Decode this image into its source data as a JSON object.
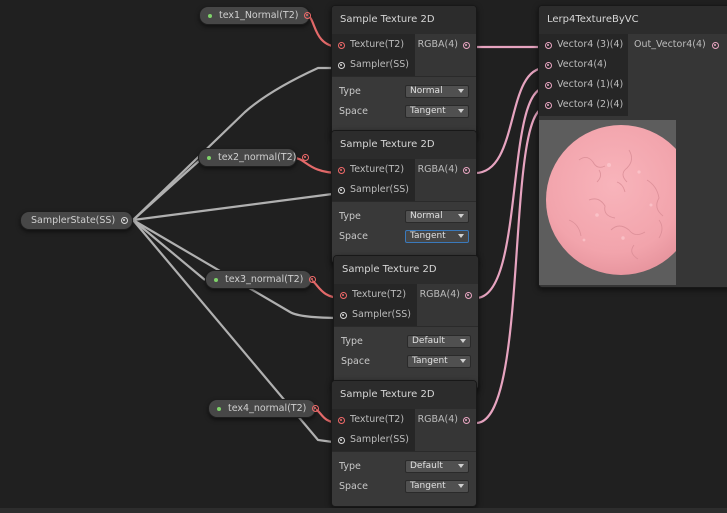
{
  "properties": [
    {
      "label": "tex1_Normal(T2)"
    },
    {
      "label": "tex2_normal(T2)"
    },
    {
      "label": "tex3_normal(T2)"
    },
    {
      "label": "tex4_normal(T2)"
    },
    {
      "label": "SamplerState(SS)"
    }
  ],
  "sample_nodes": [
    {
      "title": "Sample Texture 2D",
      "in_texture": "Texture(T2)",
      "in_sampler": "Sampler(SS)",
      "out_rgba": "RGBA(4)",
      "type_label": "Type",
      "type_value": "Normal",
      "space_label": "Space",
      "space_value": "Tangent"
    },
    {
      "title": "Sample Texture 2D",
      "in_texture": "Texture(T2)",
      "in_sampler": "Sampler(SS)",
      "out_rgba": "RGBA(4)",
      "type_label": "Type",
      "type_value": "Normal",
      "space_label": "Space",
      "space_value": "Tangent"
    },
    {
      "title": "Sample Texture 2D",
      "in_texture": "Texture(T2)",
      "in_sampler": "Sampler(SS)",
      "out_rgba": "RGBA(4)",
      "type_label": "Type",
      "type_value": "Default",
      "space_label": "Space",
      "space_value": "Tangent"
    },
    {
      "title": "Sample Texture 2D",
      "in_texture": "Texture(T2)",
      "in_sampler": "Sampler(SS)",
      "out_rgba": "RGBA(4)",
      "type_label": "Type",
      "type_value": "Default",
      "space_label": "Space",
      "space_value": "Tangent"
    }
  ],
  "lerp_node": {
    "title": "Lerp4TextureByVC",
    "inputs": [
      "Vector4 (3)(4)",
      "Vector4(4)",
      "Vector4 (1)(4)",
      "Vector4 (2)(4)"
    ],
    "output": "Out_Vector4(4)"
  },
  "colors": {
    "background": "#202020",
    "texture_port": "#f06a6a",
    "vector_port": "#e9a6c2",
    "sampler_wire": "#b4b4b4",
    "preview_sphere": "#f4a6ae"
  }
}
